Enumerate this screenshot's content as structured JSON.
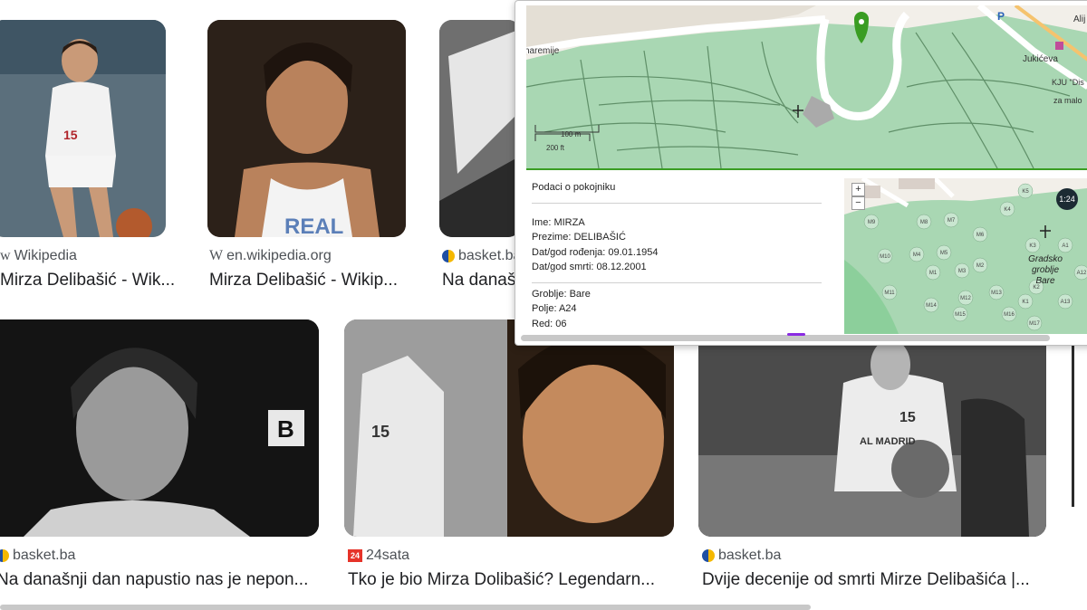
{
  "results": [
    {
      "source": "Wikipedia",
      "title": "Mirza Delibašić - Wik..."
    },
    {
      "source": "en.wikipedia.org",
      "title": "Mirza Delibašić - Wikip..."
    },
    {
      "source": "basket.ba",
      "title": "Na današ"
    },
    {
      "source": "basket.ba",
      "title": "Na današnji dan napustio nas je nepon..."
    },
    {
      "source": "24sata",
      "title": "Tko je bio Mirza Dolibašić? Legendarn..."
    },
    {
      "source": "basket.ba",
      "title": "Dvije decenije od smrti Mirze Delibašića |..."
    }
  ],
  "favicons": {
    "wikipedia": "W",
    "24sata": "24"
  },
  "photo_text": {
    "jersey1": "15",
    "jersey2": "REAL",
    "jersey3": "15",
    "jersey4": "15",
    "jersey5": "AL MADRID",
    "card_e": "B"
  },
  "map_top": {
    "street1": "haremije",
    "street2": "Jukićeva",
    "poi": "KJU \"Dis",
    "poi2": "za malo",
    "parking": "P",
    "alija": "Alij",
    "scale_m": "100 m",
    "scale_ft": "200 ft"
  },
  "info": {
    "heading": "Podaci o pokojniku",
    "name": "Ime: MIRZA",
    "surname": "Prezime: DELIBAŠIĆ",
    "born": "Dat/god rođenja: 09.01.1954",
    "died": "Dat/god smrti: 08.12.2001",
    "cemetery": "Groblje: Bare",
    "field": "Polje: A24",
    "row": "Red: 06"
  },
  "map_small": {
    "zoom_in": "+",
    "zoom_out": "−",
    "badge": "1:24",
    "label1": "Gradsko",
    "label2": "groblje",
    "label3": "Bare",
    "plots": [
      "K5",
      "K4",
      "M9",
      "M8",
      "M7",
      "M6",
      "M5",
      "M10",
      "M4",
      "M3",
      "M2",
      "M1",
      "K3",
      "K2",
      "M11",
      "M12",
      "M13",
      "K1",
      "M14",
      "M15",
      "M16",
      "M17",
      "A13",
      "A1",
      "A12"
    ]
  },
  "colors": {
    "accent_green": "#3a9d23",
    "map_green": "#a9d7b3",
    "map_bg": "#f2efe9",
    "road": "#ffffff"
  }
}
